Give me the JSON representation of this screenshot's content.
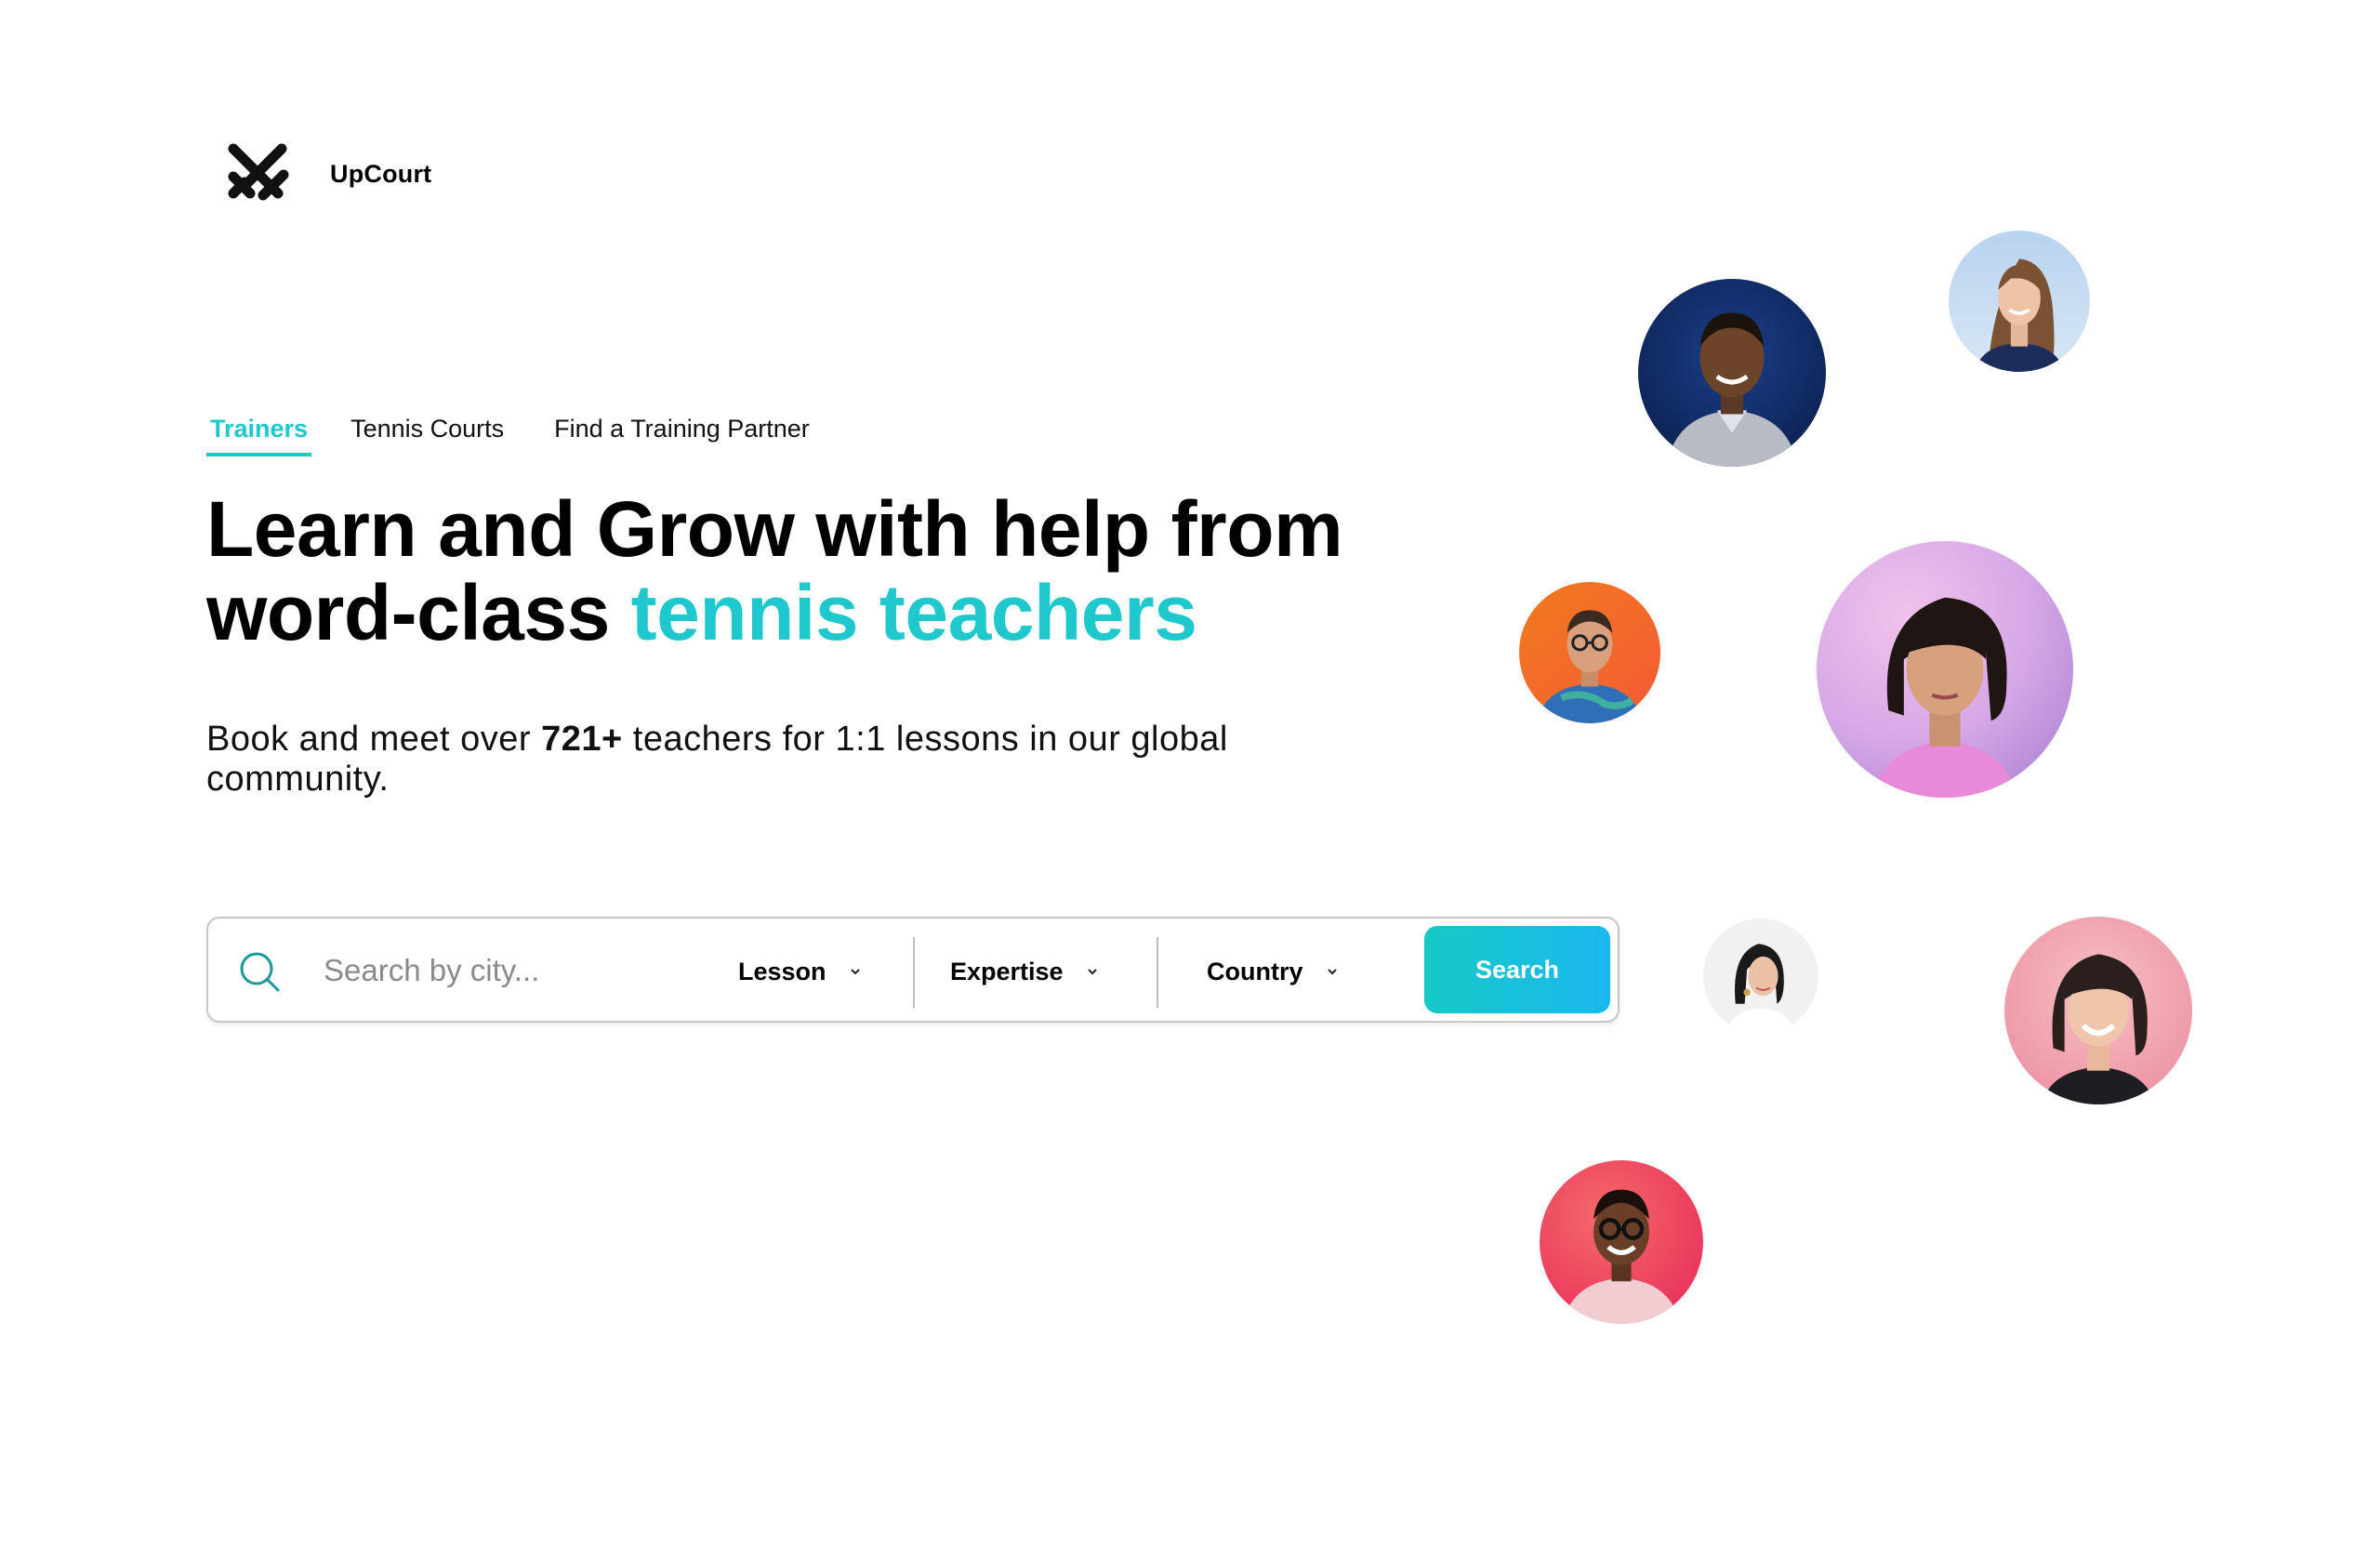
{
  "brand": {
    "name": "UpCourt",
    "logo_icon": "upcourt-logo-icon"
  },
  "nav": {
    "tabs": [
      {
        "label": "Trainers",
        "active": true
      },
      {
        "label": "Tennis Courts",
        "active": false
      },
      {
        "label": "Find a Training Partner",
        "active": false
      }
    ]
  },
  "hero": {
    "headline_part1": "Learn and Grow with help from",
    "headline_part2": "word-class ",
    "headline_accent": "tennis teachers",
    "sub_before": "Book and meet over ",
    "sub_count": "721+",
    "sub_after": " teachers for 1:1 lessons in our global community."
  },
  "search": {
    "placeholder": "Search by city...",
    "value": "",
    "filters": {
      "lesson": "Lesson",
      "expertise": "Expertise",
      "country": "Country"
    },
    "button_label": "Search"
  },
  "colors": {
    "accent": "#1ec8cc",
    "button_gradient_start": "#17c9c6",
    "button_gradient_end": "#1ab8f0",
    "text": "#000000"
  },
  "icons": [
    "search-icon",
    "chevron-down-icon"
  ]
}
